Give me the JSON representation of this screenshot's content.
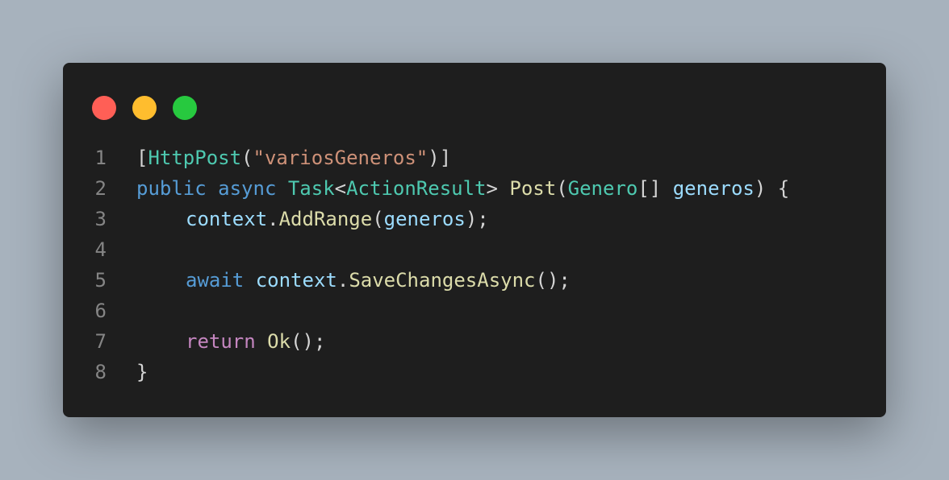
{
  "colors": {
    "background": "#a7b2bd",
    "editor_bg": "#1e1e1e",
    "line_number": "#858585",
    "default": "#d4d4d4",
    "keyword": "#569cd6",
    "control": "#c586c0",
    "type": "#4ec9b0",
    "string": "#ce9178",
    "function": "#dcdcaa",
    "variable": "#9cdcfe",
    "traffic_red": "#ff5f56",
    "traffic_yellow": "#ffbd2e",
    "traffic_green": "#27c93f"
  },
  "window_controls": [
    "close",
    "minimize",
    "maximize"
  ],
  "lines": [
    {
      "number": "1",
      "indent": false,
      "tokens": [
        {
          "text": "[",
          "kind": "default"
        },
        {
          "text": "HttpPost",
          "kind": "type"
        },
        {
          "text": "(",
          "kind": "default"
        },
        {
          "text": "\"variosGeneros\"",
          "kind": "string"
        },
        {
          "text": ")]",
          "kind": "default"
        }
      ]
    },
    {
      "number": "2",
      "indent": false,
      "tokens": [
        {
          "text": "public",
          "kind": "keyword"
        },
        {
          "text": " ",
          "kind": "default"
        },
        {
          "text": "async",
          "kind": "keyword"
        },
        {
          "text": " ",
          "kind": "default"
        },
        {
          "text": "Task",
          "kind": "type"
        },
        {
          "text": "<",
          "kind": "default"
        },
        {
          "text": "ActionResult",
          "kind": "type"
        },
        {
          "text": "> ",
          "kind": "default"
        },
        {
          "text": "Post",
          "kind": "function"
        },
        {
          "text": "(",
          "kind": "default"
        },
        {
          "text": "Genero",
          "kind": "type"
        },
        {
          "text": "[] ",
          "kind": "default"
        },
        {
          "text": "generos",
          "kind": "variable"
        },
        {
          "text": ") {",
          "kind": "default"
        }
      ]
    },
    {
      "number": "3",
      "indent": true,
      "tokens": [
        {
          "text": "context",
          "kind": "variable"
        },
        {
          "text": ".",
          "kind": "default"
        },
        {
          "text": "AddRange",
          "kind": "function"
        },
        {
          "text": "(",
          "kind": "default"
        },
        {
          "text": "generos",
          "kind": "variable"
        },
        {
          "text": ");",
          "kind": "default"
        }
      ]
    },
    {
      "number": "4",
      "indent": false,
      "tokens": []
    },
    {
      "number": "5",
      "indent": true,
      "tokens": [
        {
          "text": "await",
          "kind": "keyword"
        },
        {
          "text": " ",
          "kind": "default"
        },
        {
          "text": "context",
          "kind": "variable"
        },
        {
          "text": ".",
          "kind": "default"
        },
        {
          "text": "SaveChangesAsync",
          "kind": "function"
        },
        {
          "text": "();",
          "kind": "default"
        }
      ]
    },
    {
      "number": "6",
      "indent": false,
      "tokens": []
    },
    {
      "number": "7",
      "indent": true,
      "tokens": [
        {
          "text": "return",
          "kind": "control"
        },
        {
          "text": " ",
          "kind": "default"
        },
        {
          "text": "Ok",
          "kind": "function"
        },
        {
          "text": "();",
          "kind": "default"
        }
      ]
    },
    {
      "number": "8",
      "indent": false,
      "tokens": [
        {
          "text": "}",
          "kind": "default"
        }
      ]
    }
  ]
}
